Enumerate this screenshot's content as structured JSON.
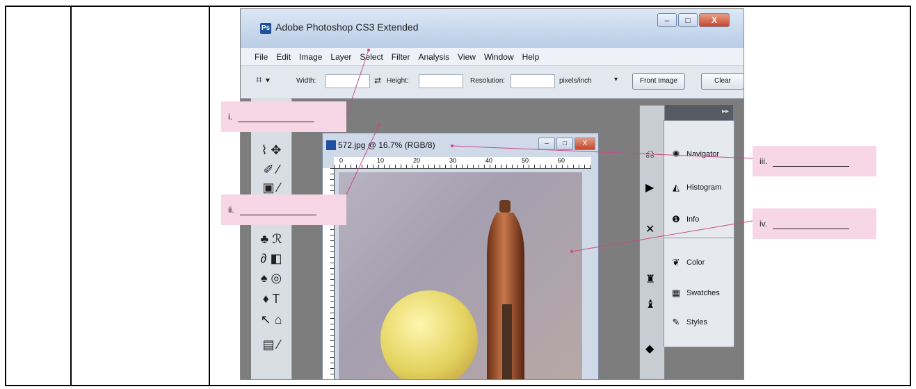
{
  "window": {
    "title": "Adobe Photoshop CS3 Extended",
    "logo": "Ps",
    "controls": [
      "–",
      "□",
      "X"
    ]
  },
  "menu": [
    "File",
    "Edit",
    "Image",
    "Layer",
    "Select",
    "Filter",
    "Analysis",
    "View",
    "Window",
    "Help"
  ],
  "options": {
    "width_label": "Width:",
    "height_label": "Height:",
    "resolution_label": "Resolution:",
    "units": "pixels/inch",
    "front_image": "Front Image",
    "clear": "Clear"
  },
  "document": {
    "title": "572.jpg @ 16.7% (RGB/8)",
    "ruler_marks": [
      "0",
      "10",
      "20",
      "30",
      "40",
      "50",
      "60"
    ]
  },
  "panels": [
    {
      "label": "Navigator",
      "icon": "navigator-icon"
    },
    {
      "label": "Histogram",
      "icon": "histogram-icon"
    },
    {
      "label": "Info",
      "icon": "info-icon"
    },
    {
      "label": "Color",
      "icon": "color-icon"
    },
    {
      "label": "Swatches",
      "icon": "swatches-icon"
    },
    {
      "label": "Styles",
      "icon": "styles-icon"
    }
  ],
  "callouts": {
    "i": "i.",
    "ii": "ii.",
    "iii": "iii.",
    "iv": "iv."
  },
  "colors": {
    "callout_bg": "#f7d7e6",
    "workspace": "#7d7d7d",
    "title_gradient_top": "#dbe7f5"
  }
}
